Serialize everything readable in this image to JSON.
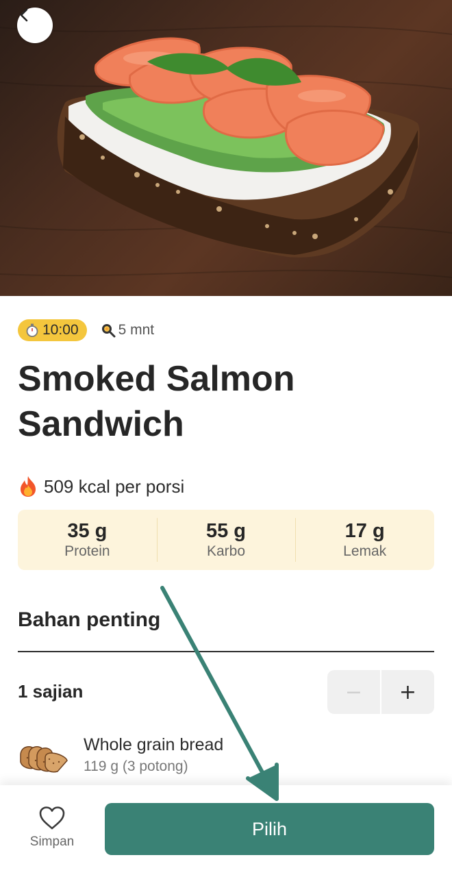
{
  "hero": {
    "image_desc": "smoked-salmon-sandwich-photo"
  },
  "meta": {
    "timer": "10:00",
    "prep_time": "5 mnt"
  },
  "recipe": {
    "title": "Smoked Salmon Sandwich",
    "calories": "509 kcal per porsi",
    "macros": [
      {
        "value": "35 g",
        "label": "Protein"
      },
      {
        "value": "55 g",
        "label": "Karbo"
      },
      {
        "value": "17 g",
        "label": "Lemak"
      }
    ]
  },
  "ingredients_section": {
    "title": "Bahan penting",
    "servings": "1 sajian",
    "minus": "−",
    "plus": "+",
    "items": [
      {
        "name": "Whole grain bread",
        "quantity": "119 g (3 potong)"
      }
    ]
  },
  "bottom": {
    "save_label": "Simpan",
    "choose_label": "Pilih"
  },
  "colors": {
    "accent": "#3a8275",
    "timer_pill": "#f4c63d",
    "macro_bg": "#fdf4dc",
    "arrow": "#3a8275"
  }
}
